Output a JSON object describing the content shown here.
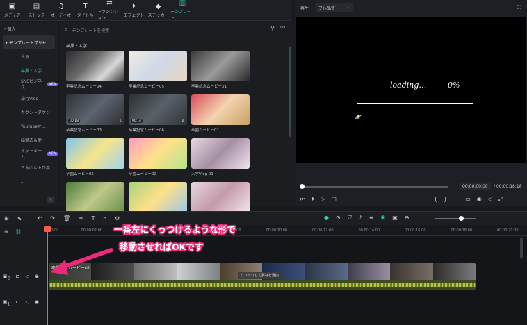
{
  "tabs": [
    {
      "label": "メディア",
      "icon": "media-icon",
      "glyph": "▣"
    },
    {
      "label": "ストック",
      "icon": "stock-icon",
      "glyph": "▤"
    },
    {
      "label": "オーディオ",
      "icon": "audio-icon",
      "glyph": "♫"
    },
    {
      "label": "タイトル",
      "icon": "title-icon",
      "glyph": "T"
    },
    {
      "label": "トランジション",
      "icon": "transition-icon",
      "glyph": "⇄"
    },
    {
      "label": "エフェクト",
      "icon": "effect-icon",
      "glyph": "✦"
    },
    {
      "label": "ステッカー",
      "icon": "sticker-icon",
      "glyph": "◆"
    },
    {
      "label": "テンプレート",
      "icon": "template-icon",
      "glyph": "▥",
      "active": true
    }
  ],
  "sidebar": {
    "personal": "個人",
    "preset": "テンプレートプリセ...",
    "items": [
      {
        "label": "人気"
      },
      {
        "label": "卒業・入学",
        "active": true
      },
      {
        "label": "SNSビジネス",
        "badge": "NEW"
      },
      {
        "label": "旅行Vlog"
      },
      {
        "label": "カウントダウン"
      },
      {
        "label": "Youtubeオ..."
      },
      {
        "label": "結婚式＆愛"
      },
      {
        "label": "ネットミーム",
        "badge": "NEW"
      },
      {
        "label": "日本のレトロ風"
      },
      {
        "label": "..."
      }
    ]
  },
  "browser": {
    "search_placeholder": "テンプレートを検索",
    "section_title": "卒業・入学",
    "cards": [
      {
        "caption": "卒業記念ムービー04",
        "duration": "",
        "bg": "linear-gradient(135deg,#2b2b2b,#6a6a6a 40%,#d8d8d8 70%,#3a3a3a)"
      },
      {
        "caption": "卒業記念ムービー05",
        "duration": "",
        "bg": "linear-gradient(135deg,#f0ece4,#cfd8e6 50%,#e9d6c0)"
      },
      {
        "caption": "卒業記念ムービー01",
        "duration": "",
        "bg": "linear-gradient(135deg,#3a3a3a,#9a9a9a 50%,#2a2a2a)"
      },
      {
        "caption": "卒業記念ムービー03",
        "duration": "00:18",
        "bg": "linear-gradient(135deg,#2e3136,#5d6470 50%,#2a2c30)"
      },
      {
        "caption": "卒業記念ムービー06",
        "duration": "00:14",
        "bg": "linear-gradient(135deg,#2c2f33,#596068 50%,#31353a)"
      },
      {
        "caption": "卒園ムービー01",
        "duration": "",
        "bg": "linear-gradient(135deg,#d94c5c,#f3d3b0 50%,#c8a060)"
      },
      {
        "caption": "卒園ムービー05",
        "duration": "",
        "bg": "linear-gradient(135deg,#7fc4ee,#f6e58a 50%,#9fd3f0)"
      },
      {
        "caption": "卒園ムービー02",
        "duration": "",
        "bg": "linear-gradient(135deg,#ff9ac0,#ffe28a 50%,#b5e38d)"
      },
      {
        "caption": "入学Vlog 01",
        "duration": "",
        "bg": "linear-gradient(135deg,#e6d7e2,#a58fa4 50%,#f0e6ee)"
      },
      {
        "caption": "",
        "duration": "",
        "bg": "linear-gradient(135deg,#4d7c3b,#bfc88a 50%,#6c8f4c)"
      },
      {
        "caption": "",
        "duration": "",
        "bg": "linear-gradient(135deg,#a6d47a,#ffe08a 50%,#9bc8e8)"
      },
      {
        "caption": "",
        "duration": "",
        "bg": "linear-gradient(135deg,#e7d6de,#c29aac 50%,#f3e6ea)"
      }
    ]
  },
  "preview": {
    "play_label": "再生",
    "quality": "フル品質",
    "loading": "loading…",
    "percent": "0%",
    "time_current": "00:00:00:00",
    "time_total": "/ 00:00:18:18",
    "playback_progress": 0.0
  },
  "ruler_ticks": [
    "00:00",
    "00:00:02:00",
    "00:00:04:00",
    "00:00:06:00",
    "00:00:08:00",
    "00:00:10:00",
    "00:00:12:00",
    "00:00:14:00",
    "00:00:16:00",
    "00:00:18:00",
    "00:00:20:00"
  ],
  "timeline": {
    "clip_label": "卒業記念ムービー01",
    "replace_tip": "クリックして素材を置換",
    "track2": "2",
    "track1": "1"
  },
  "annotation": {
    "line1": "一番左にくっつけるような形で",
    "line2": "移動させればOKです"
  },
  "colors": {
    "accent": "#2fd0b9",
    "playhead": "#ff5a45",
    "annotation_stroke": "#ec2a7a"
  }
}
